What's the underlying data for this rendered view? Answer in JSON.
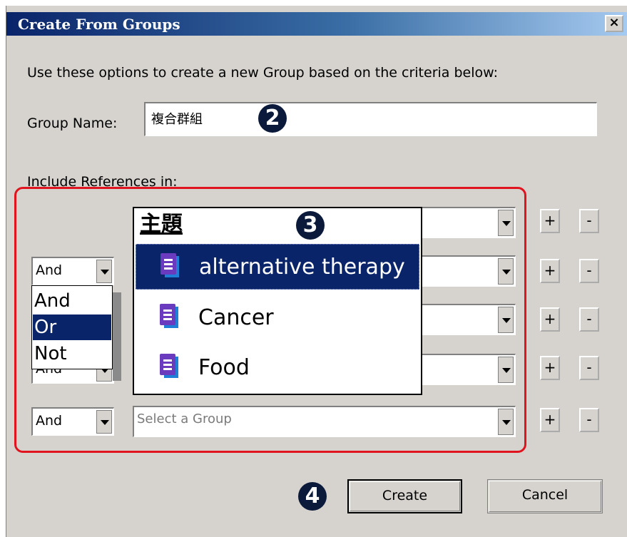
{
  "window": {
    "title": "Create From Groups",
    "close_label": "×"
  },
  "instructions": "Use these options to create a new Group based on the criteria below:",
  "group_name": {
    "label": "Group Name:",
    "value": "複合群組"
  },
  "include_label": "Include References in:",
  "callouts": {
    "step2": "2",
    "step3": "3",
    "step4": "4"
  },
  "rows": [
    {
      "operator": "",
      "group_value": ""
    },
    {
      "operator": "And",
      "group_value": ""
    },
    {
      "operator": "",
      "group_value": ""
    },
    {
      "operator": "And",
      "group_value": ""
    },
    {
      "operator": "And",
      "group_placeholder": "Select a Group"
    }
  ],
  "row_buttons": {
    "add": "+",
    "remove": "-"
  },
  "group_dropdown": {
    "heading": "主題",
    "items": [
      {
        "label": "alternative therapy",
        "selected": true
      },
      {
        "label": "Cancer",
        "selected": false
      },
      {
        "label": "Food",
        "selected": false
      }
    ]
  },
  "operator_dropdown": {
    "options": [
      {
        "label": "And",
        "selected": false
      },
      {
        "label": "Or",
        "selected": true
      },
      {
        "label": "Not",
        "selected": false
      }
    ]
  },
  "buttons": {
    "create": "Create",
    "cancel": "Cancel"
  },
  "colors": {
    "title_bar": "#0a246a",
    "selection": "#0a246a",
    "highlight_frame": "#e0141e",
    "group_icon": "#6a3bbf",
    "badge": "#0b1a3a"
  }
}
